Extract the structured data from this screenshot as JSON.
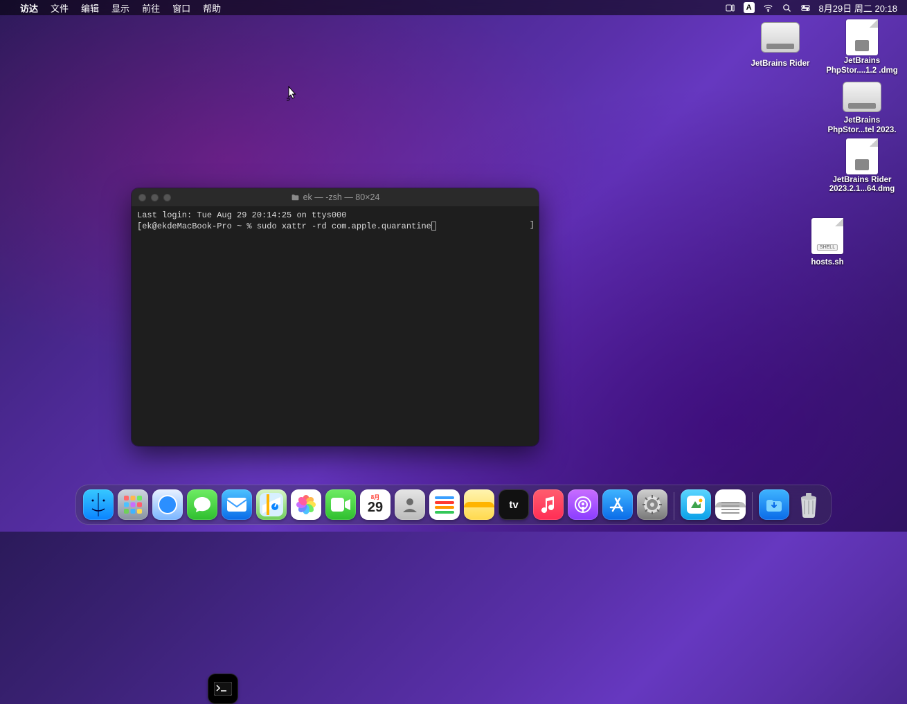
{
  "menubar": {
    "app_name": "访达",
    "items": [
      "文件",
      "编辑",
      "显示",
      "前往",
      "窗口",
      "帮助"
    ],
    "ime_letter": "A",
    "datetime": "8月29日 周二 20:18"
  },
  "desktop_icons": [
    {
      "kind": "drive",
      "label": "JetBrains Rider"
    },
    {
      "kind": "dmg",
      "label": "JetBrains PhpStor....1.2 .dmg"
    },
    {
      "kind": "drive",
      "label": "JetBrains PhpStor...tel 2023."
    },
    {
      "kind": "dmg",
      "label": "JetBrains Rider 2023.2.1...64.dmg"
    },
    {
      "kind": "sh",
      "label": "hosts.sh",
      "tag": "SHELL"
    }
  ],
  "terminal": {
    "title": "ek — -zsh — 80×24",
    "line1": "Last login: Tue Aug 29 20:14:25 on ttys000",
    "prompt_left": "[",
    "prompt_host": "ek@ekdeMacBook-Pro ~ % ",
    "command": "sudo xattr -rd com.apple.quarantine",
    "right_bracket": "]"
  },
  "dock": {
    "calendar_month": "8月",
    "calendar_day": "29",
    "items": [
      "finder",
      "launchpad",
      "safari",
      "messages",
      "mail",
      "maps",
      "photos",
      "facetime",
      "calendar",
      "contacts",
      "reminders",
      "notes",
      "tv",
      "music",
      "podcasts",
      "appstore",
      "settings",
      "SEP",
      "terminal",
      "app2",
      "textedit",
      "SEP",
      "downloads",
      "trash"
    ]
  }
}
